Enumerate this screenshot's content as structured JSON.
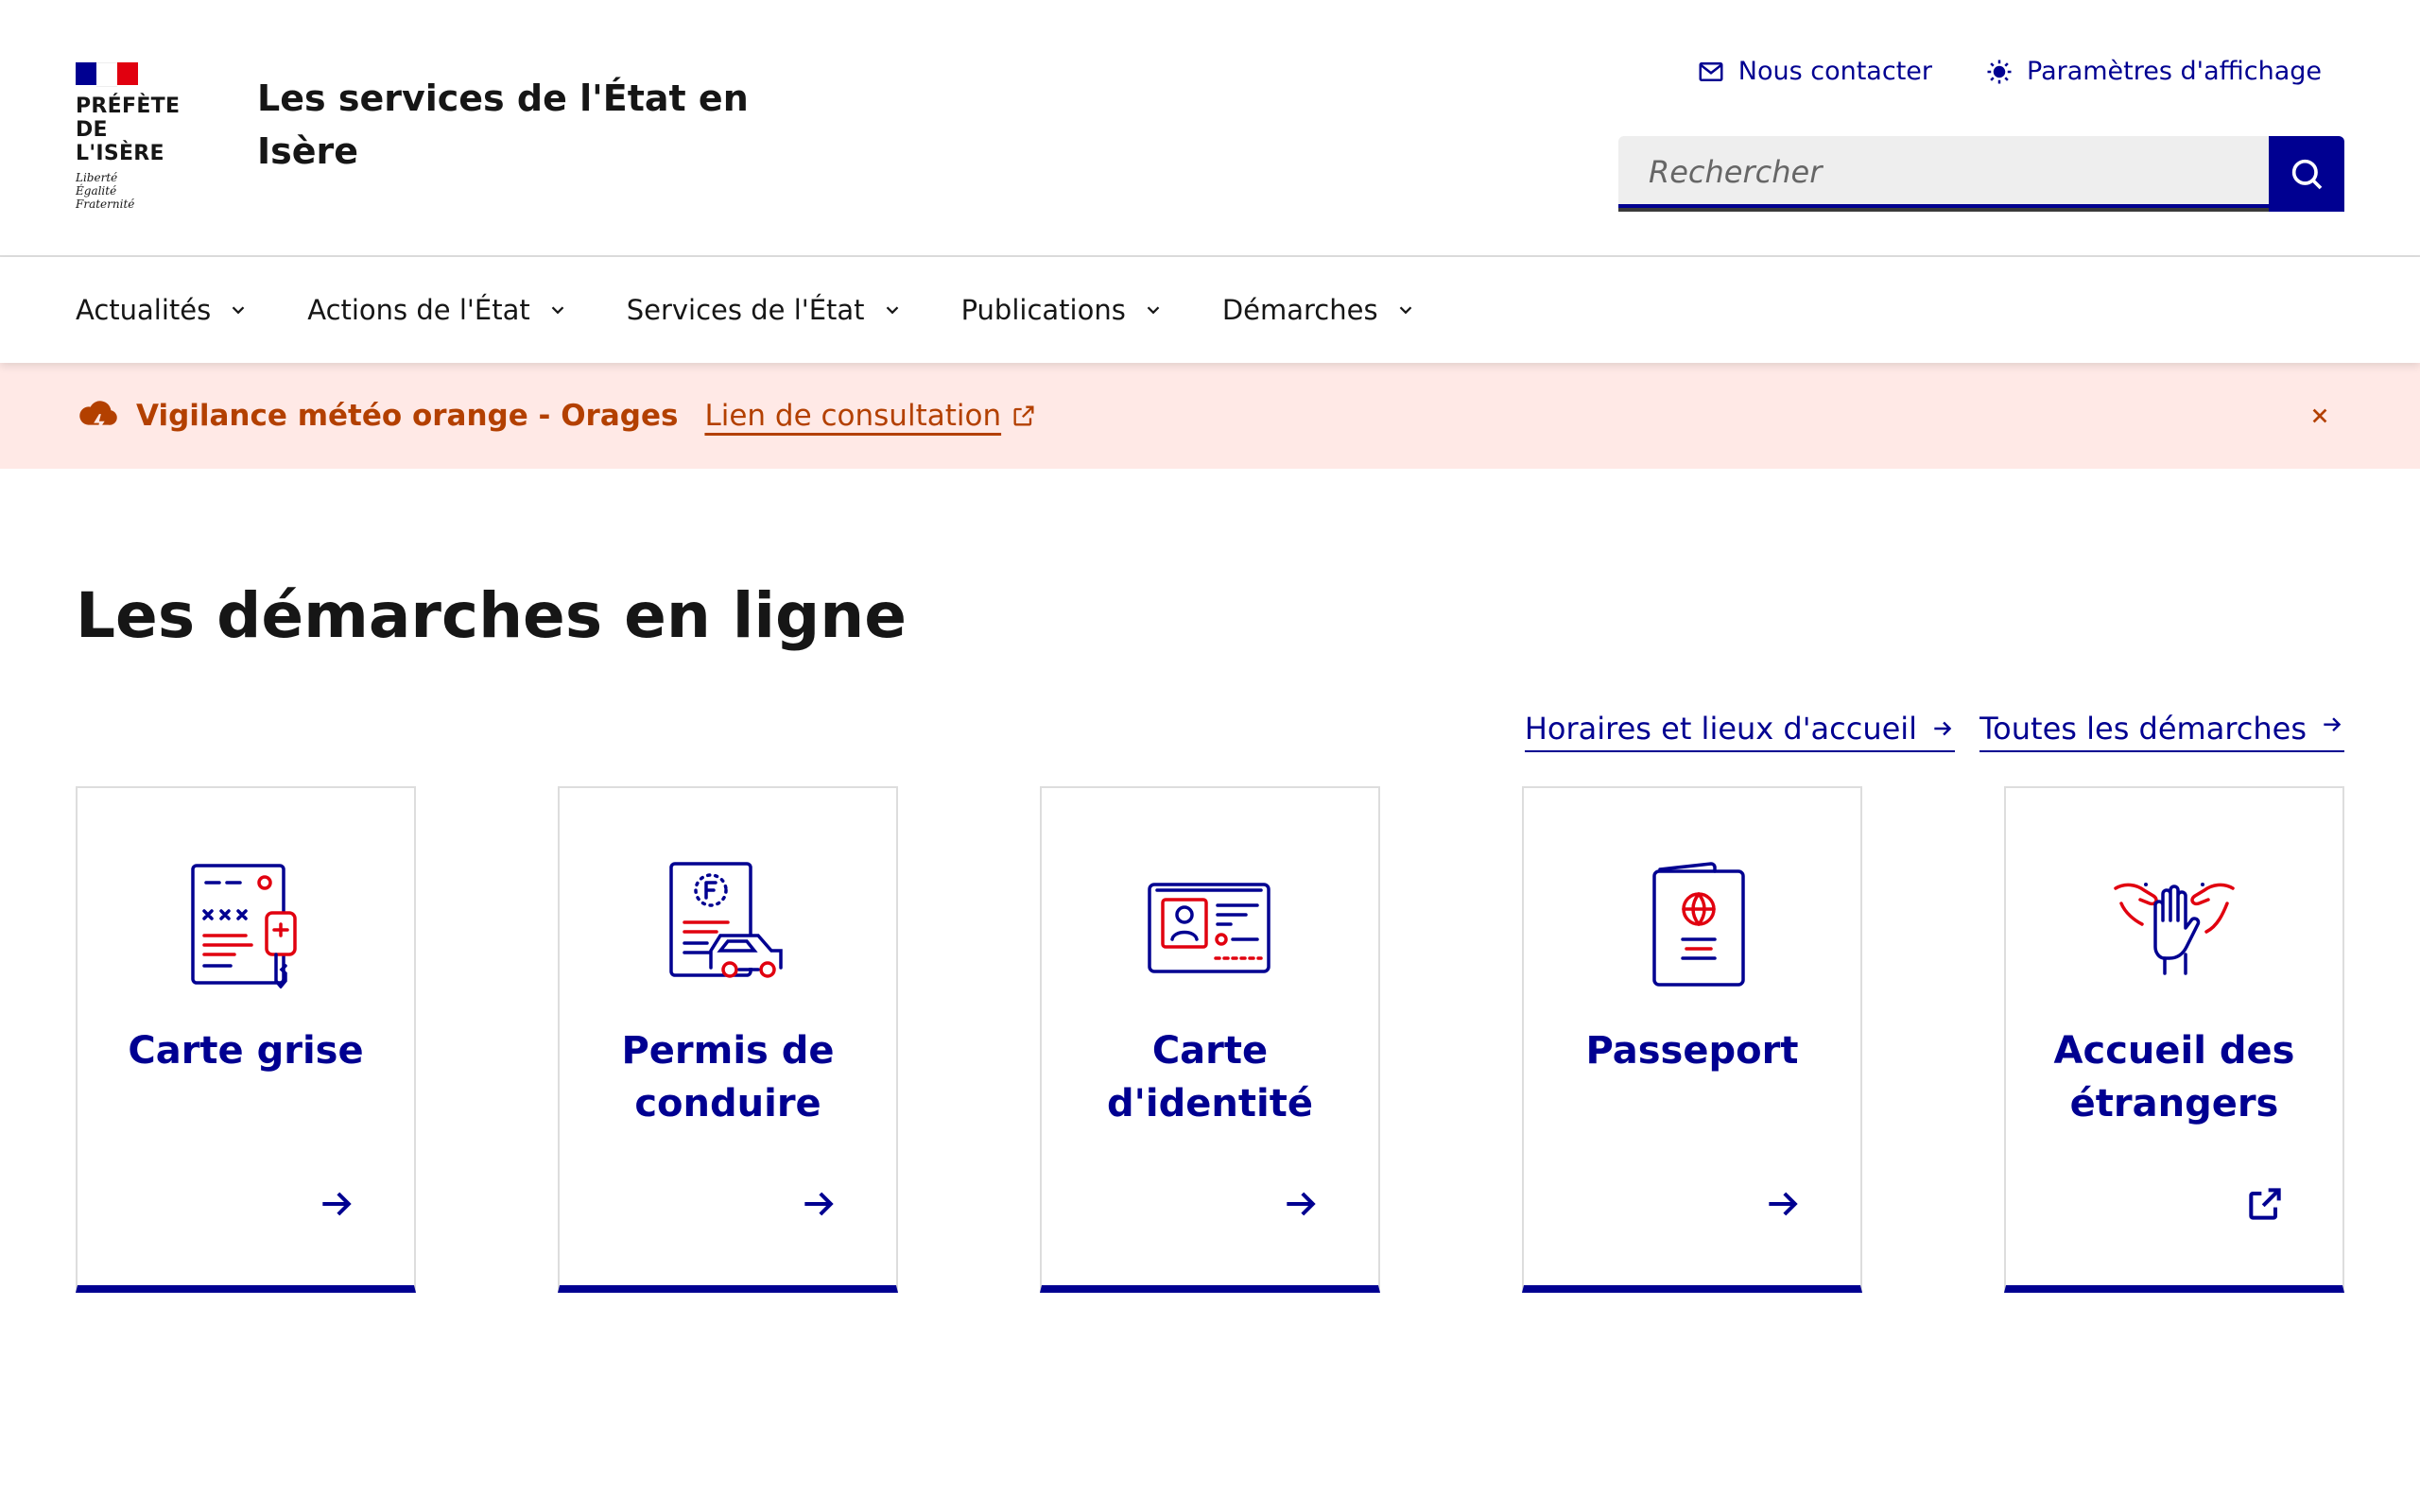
{
  "header": {
    "logo": {
      "flag_colors": [
        "#000091",
        "#ffffff",
        "#e1000f"
      ],
      "name_line1": "PRÉFÈTE",
      "name_line2": "DE L'ISÈRE",
      "devise": [
        "Liberté",
        "Égalité",
        "Fraternité"
      ]
    },
    "site_title": "Les services de l'État en Isère",
    "tools": [
      {
        "label": "Nous contacter",
        "icon": "mail-icon"
      },
      {
        "label": "Paramètres d'affichage",
        "icon": "theme-sun-icon"
      }
    ],
    "search": {
      "placeholder": "Rechercher",
      "value": "",
      "icon": "search-icon"
    }
  },
  "nav": {
    "items": [
      {
        "label": "Actualités"
      },
      {
        "label": "Actions de l'État"
      },
      {
        "label": "Services de l'État"
      },
      {
        "label": "Publications"
      },
      {
        "label": "Démarches"
      }
    ]
  },
  "notice": {
    "icon": "thunderstorm-icon",
    "title": "Vigilance météo orange - Orages",
    "link_label": "Lien de consultation",
    "close_icon": "close-icon",
    "color": "#b34000",
    "background": "#ffe9e6"
  },
  "main": {
    "title": "Les démarches en ligne",
    "links": [
      {
        "label": "Horaires et lieux d'accueil",
        "icon": "arrow-right-icon"
      },
      {
        "label": "Toutes les démarches",
        "icon": "arrow-right-up-icon"
      }
    ],
    "cards": [
      {
        "title": "Carte grise",
        "illustration": "vehicle-registration-icon",
        "action_icon": "arrow-right-icon"
      },
      {
        "title": "Permis de conduire",
        "illustration": "driving-licence-icon",
        "action_icon": "arrow-right-icon"
      },
      {
        "title": "Carte d'identité",
        "illustration": "id-card-icon",
        "action_icon": "arrow-right-icon"
      },
      {
        "title": "Passeport",
        "illustration": "passport-icon",
        "action_icon": "arrow-right-icon"
      },
      {
        "title": "Accueil des étrangers",
        "illustration": "welcome-hands-icon",
        "action_icon": "external-link-icon"
      }
    ]
  },
  "colors": {
    "brand_blue": "#000091",
    "marianne_red": "#e1000f",
    "text": "#161616"
  }
}
